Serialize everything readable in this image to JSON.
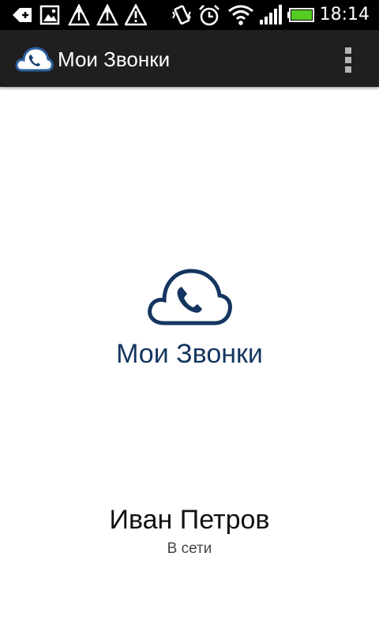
{
  "status_bar": {
    "time": "18:14",
    "icons": [
      "back-arrow-icon",
      "picture-icon",
      "network-alert-icon",
      "network-alert-icon",
      "warning-icon",
      "vibrate-icon",
      "alarm-clock-icon",
      "wifi-icon",
      "signal-icon",
      "battery-icon"
    ],
    "battery_color": "#55cc22"
  },
  "action_bar": {
    "title": "Мои Звонки",
    "logo_icon": "cloud-phone-icon",
    "overflow_icon": "overflow-menu-icon"
  },
  "main": {
    "logo_icon": "cloud-phone-icon",
    "brand_text": "Мои Звонки",
    "brand_color": "#14355f"
  },
  "user": {
    "name": "Иван Петров",
    "status": "В сети"
  }
}
